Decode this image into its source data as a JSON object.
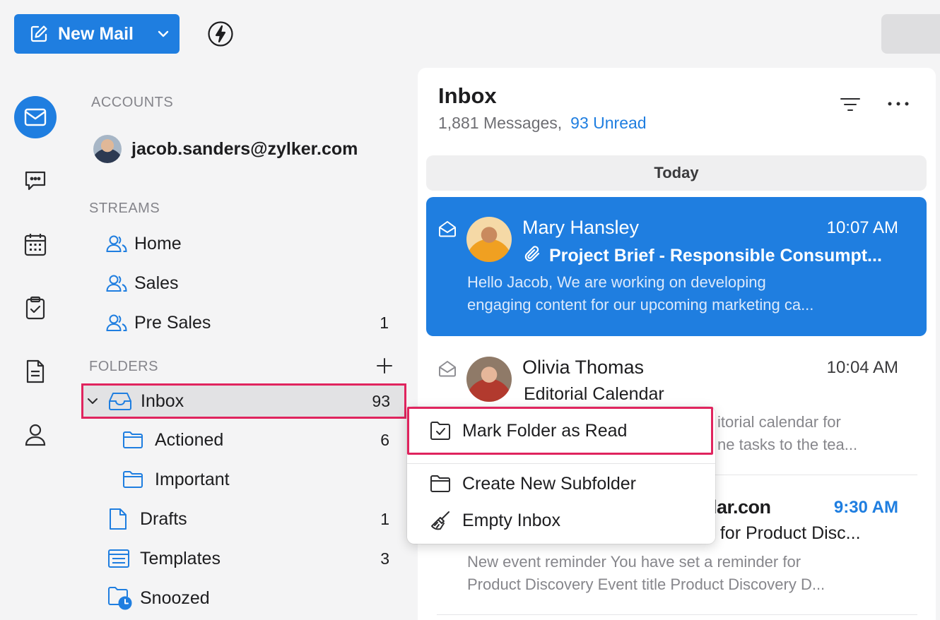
{
  "toolbar": {
    "new_mail_label": "New Mail"
  },
  "rail": {
    "items": [
      "mail",
      "chat",
      "calendar",
      "tasks",
      "notes",
      "contacts"
    ]
  },
  "sidebar": {
    "accounts_label": "ACCOUNTS",
    "account_email": "jacob.sanders@zylker.com",
    "streams_label": "STREAMS",
    "streams": [
      {
        "label": "Home",
        "count": ""
      },
      {
        "label": "Sales",
        "count": ""
      },
      {
        "label": "Pre Sales",
        "count": "1"
      }
    ],
    "folders_label": "FOLDERS",
    "folders": [
      {
        "label": "Inbox",
        "count": "93"
      },
      {
        "label": "Actioned",
        "count": "6"
      },
      {
        "label": "Important",
        "count": ""
      },
      {
        "label": "Drafts",
        "count": "1"
      },
      {
        "label": "Templates",
        "count": "3"
      },
      {
        "label": "Snoozed",
        "count": ""
      }
    ]
  },
  "mail_list": {
    "title": "Inbox",
    "messages_count": "1,881 Messages,",
    "unread_count": "93 Unread",
    "group_label": "Today",
    "items": [
      {
        "sender": "Mary Hansley",
        "time": "10:07 AM",
        "subject": "Project Brief - Responsible Consumpt...",
        "preview_line1": "Hello Jacob, We are working on developing",
        "preview_line2": "engaging content for our upcoming marketing ca..."
      },
      {
        "sender": "Olivia Thomas",
        "time": "10:04 AM",
        "subject": "Editorial Calendar",
        "preview_line1": "itorial calendar for",
        "preview_line2": "ne tasks to the tea..."
      },
      {
        "sender": "dar.con",
        "time": "9:30 AM",
        "subject": "d for Product Disc...",
        "preview_line1": "New event reminder You have set a reminder for",
        "preview_line2": "Product Discovery Event title Product Discovery D..."
      }
    ]
  },
  "context_menu": {
    "items": [
      {
        "label": "Mark Folder as Read"
      },
      {
        "label": "Create New Subfolder"
      },
      {
        "label": "Empty Inbox"
      }
    ]
  },
  "colors": {
    "accent": "#1f7ee0",
    "highlight_border": "#e0245e",
    "unread_time": "#1f7ee0"
  }
}
